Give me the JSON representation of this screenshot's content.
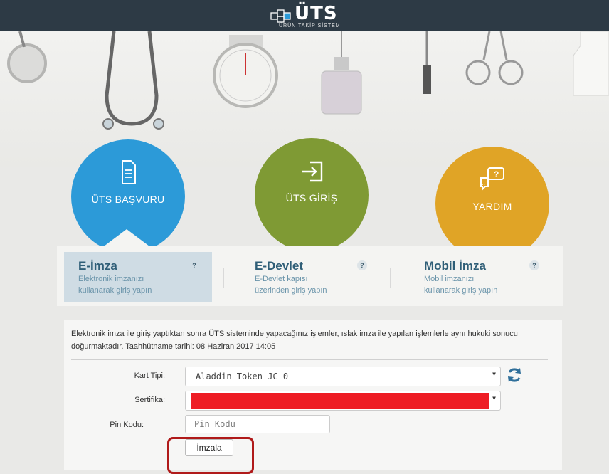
{
  "header": {
    "logo_title": "ÜTS",
    "logo_subtitle": "ÜRÜN TAKİP SİSTEMİ"
  },
  "nav_circles": [
    {
      "label": "ÜTS BAŞVURU",
      "icon": "document-icon",
      "color": "#2c9ad8"
    },
    {
      "label": "ÜTS GİRİŞ",
      "icon": "login-icon",
      "color": "#7f9a34"
    },
    {
      "label": "YARDIM",
      "icon": "chat-help-icon",
      "color": "#e0a426"
    }
  ],
  "login_tabs": [
    {
      "title": "E-İmza",
      "desc_line1": "Elektronik imzanızı",
      "desc_line2": "kullanarak giriş yapın",
      "help": "?",
      "selected": true
    },
    {
      "title": "E-Devlet",
      "desc_line1": "E-Devlet kapısı",
      "desc_line2": "üzerinden giriş yapın",
      "help": "?",
      "selected": false
    },
    {
      "title": "Mobil İmza",
      "desc_line1": "Mobil imzanızı",
      "desc_line2": "kullanarak giriş yapın",
      "help": "?",
      "selected": false
    }
  ],
  "form": {
    "info_text": "Elektronik imza ile giriş yaptıktan sonra ÜTS sisteminde yapacağınız işlemler, ıslak imza ile yapılan işlemlerle aynı hukuki sonucu doğurmaktadır. Taahhütname tarihi: 08 Haziran 2017 14:05",
    "card_type_label": "Kart Tipi:",
    "card_type_value": "Aladdin Token JC 0",
    "certificate_label": "Sertifika:",
    "certificate_value": "",
    "pin_label": "Pin Kodu:",
    "pin_placeholder": "Pin Kodu",
    "pin_value": "",
    "sign_button": "İmzala"
  },
  "colors": {
    "topbar": "#2d3a45",
    "selected_tab": "#cfdce4",
    "tab_title": "#2f5e77",
    "redacted": "#ee1c24",
    "annotation_box": "#b01a1a"
  }
}
